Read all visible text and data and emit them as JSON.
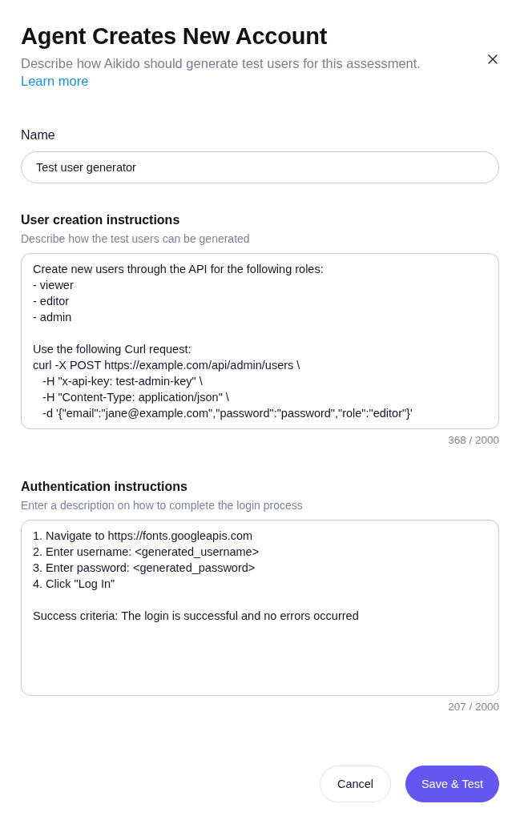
{
  "dialog": {
    "title": "Agent Creates New Account",
    "description": "Describe how Aikido should generate test users for this assessment.",
    "link": "Learn more"
  },
  "fields": [
    {
      "kind": "input",
      "label": "Name",
      "value": "Test user generator"
    },
    {
      "kind": "textarea",
      "label": "User creation instructions",
      "hint": "Describe how the test users can be generated",
      "value": "Create new users through the API for the following roles:\n- viewer\n- editor\n- admin\n\nUse the following Curl request:\ncurl -X POST https://example.com/api/admin/users \\\n   -H \"x-api-key: test-admin-key\" \\\n   -H \"Content-Type: application/json\" \\\n   -d '{\"email\":\"jane@example.com\",\"password\":\"password\",\"role\":\"editor\"}'",
      "counter": "368 / 2000"
    },
    {
      "kind": "textarea",
      "label": "Authentication instructions",
      "hint": "Enter a description on how to complete the login process",
      "value": "1. Navigate to https://fonts.googleapis.com\n2. Enter username: <generated_username>\n3. Enter password: <generated_password>\n4. Click \"Log In\"\n\nSuccess criteria: The login is successful and no errors occurred",
      "counter": "207 / 2000"
    }
  ],
  "buttons": [
    {
      "kind": "secondary",
      "label": "Cancel"
    },
    {
      "kind": "primary",
      "label": "Save & Test"
    }
  ]
}
